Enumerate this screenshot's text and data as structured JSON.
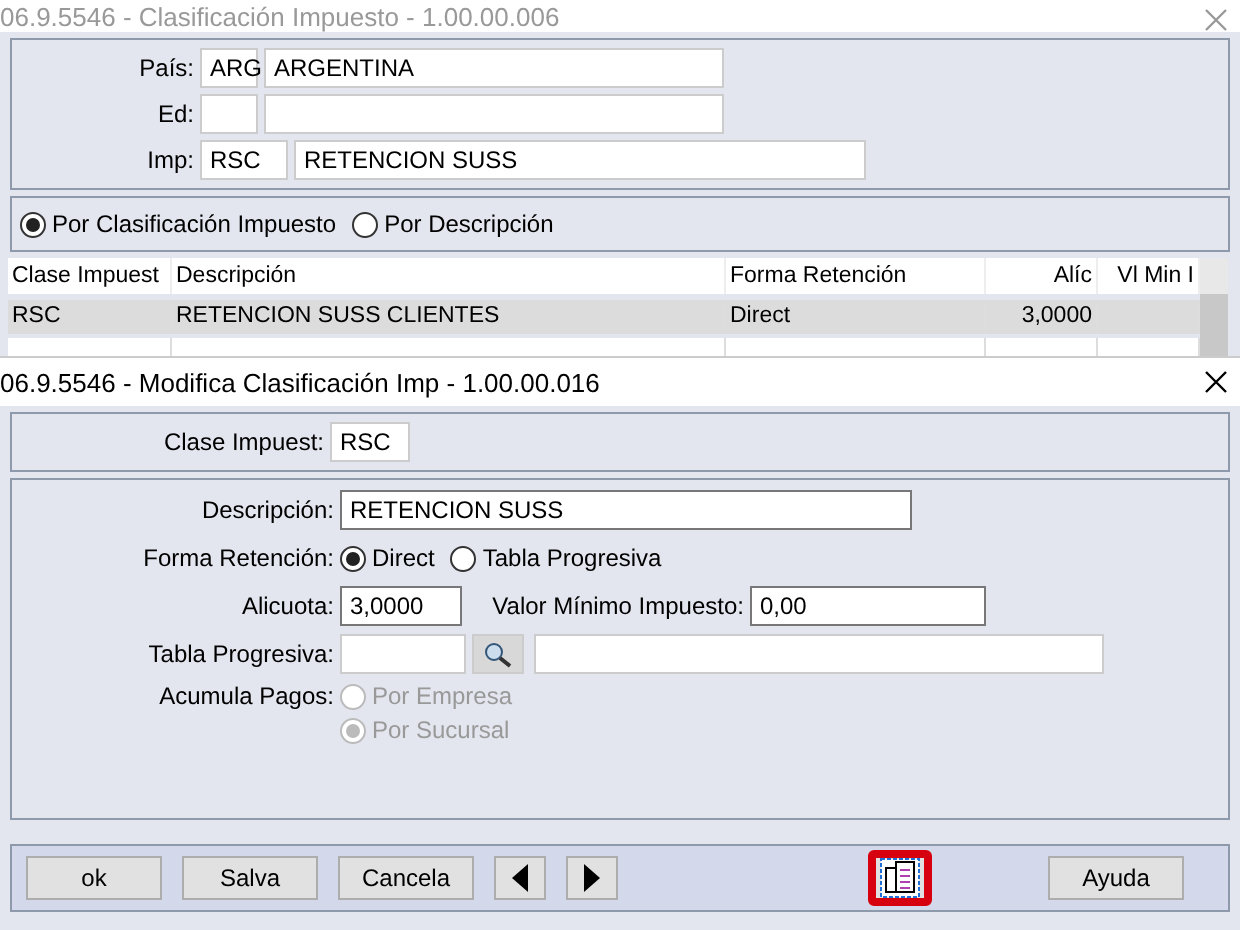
{
  "back_window": {
    "title": "06.9.5546 - Clasificación Impuesto - 1.00.00.006",
    "fields": [
      {
        "label": "País:",
        "code": "ARG",
        "value": "ARGENTINA"
      },
      {
        "label": "Ed:"
      },
      {
        "label": "Imp:",
        "code": "RSC",
        "value": "RETENCION SUSS"
      }
    ],
    "order": [
      {
        "label": "Por Clasificación Impuesto",
        "selected": true
      },
      {
        "label": "Por Descripción",
        "selected": false
      }
    ],
    "table": {
      "columns": [
        "Clase Impuest",
        "Descripción",
        "Forma Retención",
        "Alíc",
        "Vl Min I"
      ],
      "rows": [
        {
          "cells": [
            "RSC",
            "RETENCION SUSS CLIENTES",
            "Direct",
            "3,0000"
          ],
          "selected": true
        }
      ]
    }
  },
  "front_window": {
    "title": "06.9.5546 - Modifica Clasificación Imp - 1.00.00.016",
    "clase": {
      "label": "Clase Impuest:",
      "value": "RSC"
    },
    "descripcion": {
      "label": "Descripción:",
      "value": "RETENCION SUSS"
    },
    "forma_retencion": {
      "label": "Forma Retención:",
      "options": [
        {
          "label": "Direct",
          "selected": true
        },
        {
          "label": "Tabla Progresiva",
          "selected": false
        }
      ]
    },
    "alicuota": {
      "label": "Alicuota:",
      "value": "3,0000"
    },
    "valor_minimo": {
      "label": "Valor Mínimo Impuesto:",
      "value": "0,00"
    },
    "tabla_progresiva": {
      "label": "Tabla Progresiva:"
    },
    "acumula_pagos": {
      "label": "Acumula Pagos:",
      "options": [
        {
          "label": "Por Empresa",
          "selected": false,
          "disabled": true
        },
        {
          "label": "Por Sucursal",
          "selected": true,
          "disabled": true
        }
      ]
    },
    "buttons": [
      {
        "kind": "text",
        "label": "ok",
        "highlighted": false
      },
      {
        "kind": "text",
        "label": "Salva",
        "highlighted": false
      },
      {
        "kind": "text",
        "label": "Cancela",
        "highlighted": false
      },
      {
        "kind": "prev",
        "highlighted": false
      },
      {
        "kind": "next",
        "highlighted": false
      },
      {
        "kind": "report",
        "highlighted": true
      },
      {
        "kind": "text",
        "label": "Ayuda",
        "highlighted": false
      }
    ]
  }
}
